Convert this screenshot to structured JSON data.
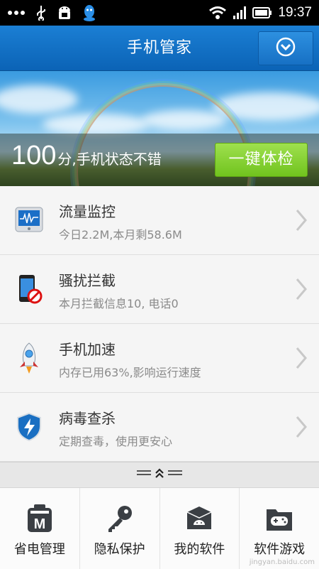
{
  "status_bar": {
    "time": "19:37"
  },
  "header": {
    "title": "手机管家"
  },
  "banner": {
    "score_value": "100",
    "score_text": "分,手机状态不错",
    "check_button": "一键体检"
  },
  "list": [
    {
      "title": "流量监控",
      "subtitle": "今日2.2M,本月剩58.6M",
      "icon": "traffic-monitor-icon"
    },
    {
      "title": "骚扰拦截",
      "subtitle": "本月拦截信息10, 电话0",
      "icon": "phone-block-icon"
    },
    {
      "title": "手机加速",
      "subtitle": "内存已用63%,影响运行速度",
      "icon": "rocket-icon"
    },
    {
      "title": "病毒查杀",
      "subtitle": "定期查毒，使用更安心",
      "icon": "shield-icon"
    }
  ],
  "dock": [
    {
      "label": "省电管理",
      "icon": "battery-m-icon"
    },
    {
      "label": "隐私保护",
      "icon": "key-icon"
    },
    {
      "label": "我的软件",
      "icon": "android-box-icon"
    },
    {
      "label": "软件游戏",
      "icon": "gamepad-folder-icon"
    }
  ],
  "watermark": "jingyan.baidu.com",
  "colors": {
    "header": "#0b63b6",
    "check_button": "#71c31e",
    "accent_blue": "#1b7fd4"
  }
}
